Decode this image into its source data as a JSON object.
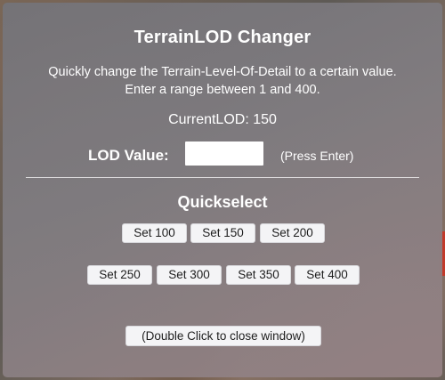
{
  "window": {
    "title": "TerrainLOD Changer",
    "description_line1": "Quickly change the Terrain-Level-Of-Detail to a certain value.",
    "description_line2": "Enter a range between 1 and 400.",
    "current_lod": "CurrentLOD: 150"
  },
  "lod_input": {
    "label": "LOD Value:",
    "value": "",
    "placeholder": "",
    "hint": "(Press Enter)"
  },
  "quickselect": {
    "title": "Quickselect",
    "buttons": [
      {
        "label": "Set 100"
      },
      {
        "label": "Set 150"
      },
      {
        "label": "Set 200"
      },
      {
        "label": "Set 250"
      },
      {
        "label": "Set 300"
      },
      {
        "label": "Set 350"
      },
      {
        "label": "Set 400"
      }
    ]
  },
  "close_button": {
    "label": "(Double Click to close window)"
  },
  "colors": {
    "panel": "#7f7b80",
    "text": "#ffffff",
    "button_bg": "#f4f4f6",
    "button_text": "#1e1e1e"
  }
}
